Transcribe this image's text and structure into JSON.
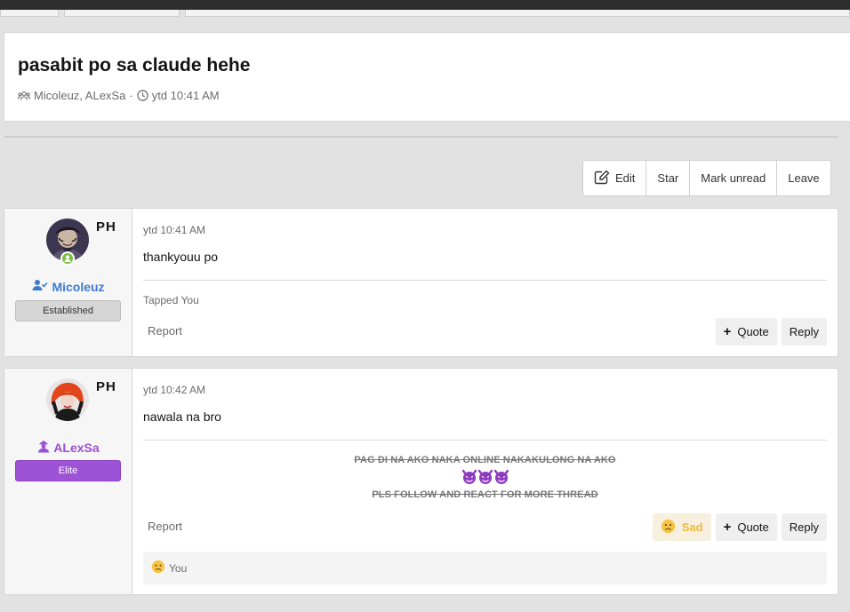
{
  "thread": {
    "title": "pasabit po sa claude hehe",
    "participants": "Micoleuz, ALexSa",
    "separator": "·",
    "time": "ytd 10:41 AM"
  },
  "actions": {
    "edit": "Edit",
    "star": "Star",
    "mark_unread": "Mark unread",
    "leave": "Leave"
  },
  "posts": [
    {
      "author": "Micoleuz",
      "flag": "PH",
      "badge": "Established",
      "time": "ytd 10:41 AM",
      "message": "thankyouu po",
      "signature": "Tapped You",
      "report": "Report",
      "quote": "Quote",
      "reply": "Reply"
    },
    {
      "author": "ALexSa",
      "flag": "PH",
      "badge": "Elite",
      "time": "ytd 10:42 AM",
      "message": "nawala na bro",
      "signature_line1": "PAG DI NA AKO NAKA ONLINE NAKAKULONG NA AKO",
      "signature_line2": "PLS FOLLOW AND REACT FOR MORE THREAD",
      "report": "Report",
      "reaction_label": "Sad",
      "quote": "Quote",
      "reply": "Reply",
      "reaction_by": "You"
    }
  ],
  "colors": {
    "user1_name": "#3f7ad0",
    "user2_name": "#9b4fd1",
    "badge_established": "#d6d6d6",
    "badge_elite": "#9e52d6",
    "online": "#7ac142",
    "sad": "#f0b93a"
  },
  "icons": {
    "participants": "users-icon",
    "time": "clock-icon",
    "edit": "edit-icon",
    "user1_role": "user-check-icon",
    "user2_role": "user-hat-icon",
    "online": "online-user-icon",
    "sad": "sad-face-icon",
    "signature_emoji": "devil-face-icon"
  }
}
